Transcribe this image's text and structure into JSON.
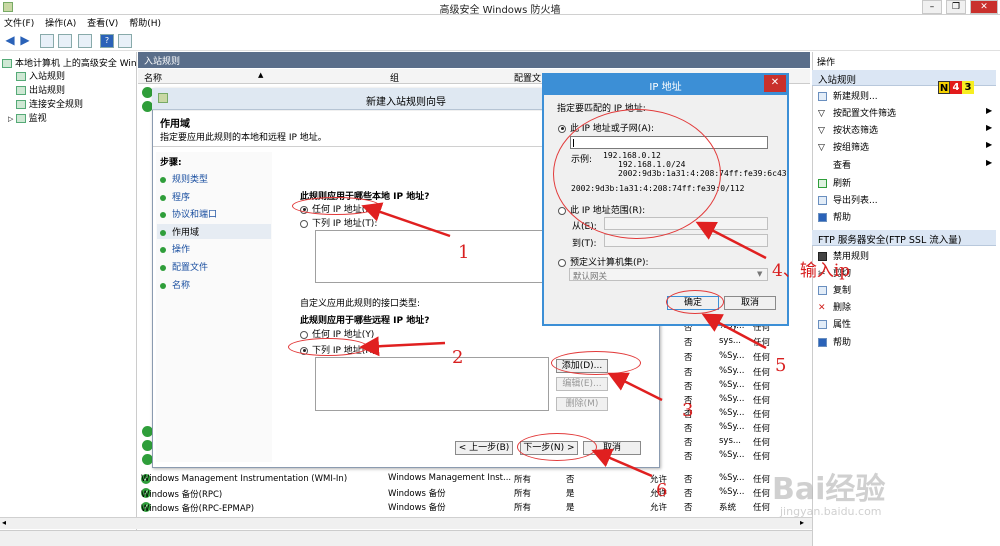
{
  "window": {
    "title": "高级安全 Windows 防火墙",
    "minimize": "–",
    "restore": "❐",
    "close": "✕"
  },
  "menu": {
    "file": "文件(F)",
    "action": "操作(A)",
    "view": "查看(V)",
    "help": "帮助(H)"
  },
  "tree": {
    "root": "本地计算机 上的高级安全 Win",
    "items": [
      "入站规则",
      "出站规则",
      "连接安全规则",
      "监视"
    ]
  },
  "center": {
    "header": "入站规则",
    "columns": {
      "name": "名称",
      "group": "组",
      "profile": "配置文"
    },
    "rows": [
      {
        "name": "Windows Management Instrumentation (WMI-In)",
        "group": "Windows Management Inst...",
        "profile": "所有",
        "enabled": "否",
        "action": "允许",
        "override": "否",
        "program": "%Sy...",
        "local": "任何"
      },
      {
        "name": "Windows 备份(RPC)",
        "group": "Windows 备份",
        "profile": "所有",
        "enabled": "是",
        "action": "允许",
        "override": "否",
        "program": "%Sy...",
        "local": "任何"
      },
      {
        "name": "Windows 备份(RPC-EPMAP)",
        "group": "Windows 备份",
        "profile": "所有",
        "enabled": "是",
        "action": "允许",
        "override": "否",
        "program": "系统",
        "local": "任何"
      }
    ],
    "visible_cols": [
      {
        "no": "否",
        "prog": "%Sy...",
        "any": "任何"
      },
      {
        "no": "否",
        "prog": "sys...",
        "any": "任何"
      },
      {
        "no": "否",
        "prog": "%Sy...",
        "any": "任何"
      },
      {
        "no": "否",
        "prog": "%Sy...",
        "any": "任何"
      },
      {
        "no": "否",
        "prog": "%Sy...",
        "any": "任何"
      },
      {
        "no": "否",
        "prog": "%Sy...",
        "any": "任何"
      },
      {
        "no": "否",
        "prog": "%Sy...",
        "any": "任何"
      },
      {
        "no": "否",
        "prog": "%Sy...",
        "any": "任何"
      },
      {
        "no": "否",
        "prog": "sys...",
        "any": "任何"
      },
      {
        "no": "否",
        "prog": "%Sy...",
        "any": "任何"
      },
      {
        "no": "否",
        "prog": "%Sy...",
        "any": "任何"
      },
      {
        "no": "否",
        "prog": "%Sy...",
        "any": "任何"
      }
    ]
  },
  "actions": {
    "title": "操作",
    "section1": "入站规则",
    "items1": [
      "新建规则...",
      "按配置文件筛选",
      "按状态筛选",
      "按组筛选",
      "查看",
      "刷新",
      "导出列表...",
      "帮助"
    ],
    "section2": "FTP 服务器安全(FTP SSL 流入量)",
    "items2": [
      "禁用规则",
      "剪切",
      "复制",
      "删除",
      "属性",
      "帮助"
    ]
  },
  "badges": {
    "n": "N",
    "four": "4",
    "three": "3"
  },
  "wizard": {
    "title": "新建入站规则向导",
    "heading": "作用域",
    "subheading": "指定要应用此规则的本地和远程 IP 地址。",
    "steps_label": "步骤:",
    "steps": [
      "规则类型",
      "程序",
      "协议和端口",
      "作用域",
      "操作",
      "配置文件",
      "名称"
    ],
    "local_q": "此规则应用于哪些本地 IP 地址?",
    "local_any": "任何 IP 地址(N)",
    "local_list": "下列 IP 地址(T):",
    "iface_label": "自定义应用此规则的接口类型:",
    "remote_q": "此规则应用于哪些远程 IP 地址?",
    "remote_any": "任何 IP 地址(Y)",
    "remote_list": "下列 IP 地址(H):",
    "add": "添加(D)...",
    "edit": "编辑(E)...",
    "remove": "删除(M)",
    "back": "< 上一步(B)",
    "next": "下一步(N) >",
    "cancel": "取消"
  },
  "ipdialog": {
    "title": "IP 地址",
    "prompt": "指定要匹配的 IP 地址:",
    "opt_subnet": "此 IP 地址或子网(A):",
    "example_label": "示例:",
    "examples": [
      "192.168.0.12",
      "192.168.1.0/24",
      "2002:9d3b:1a31:4:208:74ff:fe39:6c43",
      "2002:9d3b:1a31:4:208:74ff:fe39:0/112"
    ],
    "opt_range": "此 IP 地址范围(R):",
    "from": "从(E):",
    "to": "到(T):",
    "opt_predef": "预定义计算机集(P):",
    "predef_value": "默认网关",
    "ok": "确定",
    "cancel": "取消"
  },
  "annotations": {
    "a1": "1",
    "a2": "2",
    "a3": "3",
    "a4": "4、输入ip",
    "a5": "5",
    "a6": "6"
  },
  "watermark": {
    "brand": "Bai经验",
    "url": "jingyan.baidu.com"
  }
}
